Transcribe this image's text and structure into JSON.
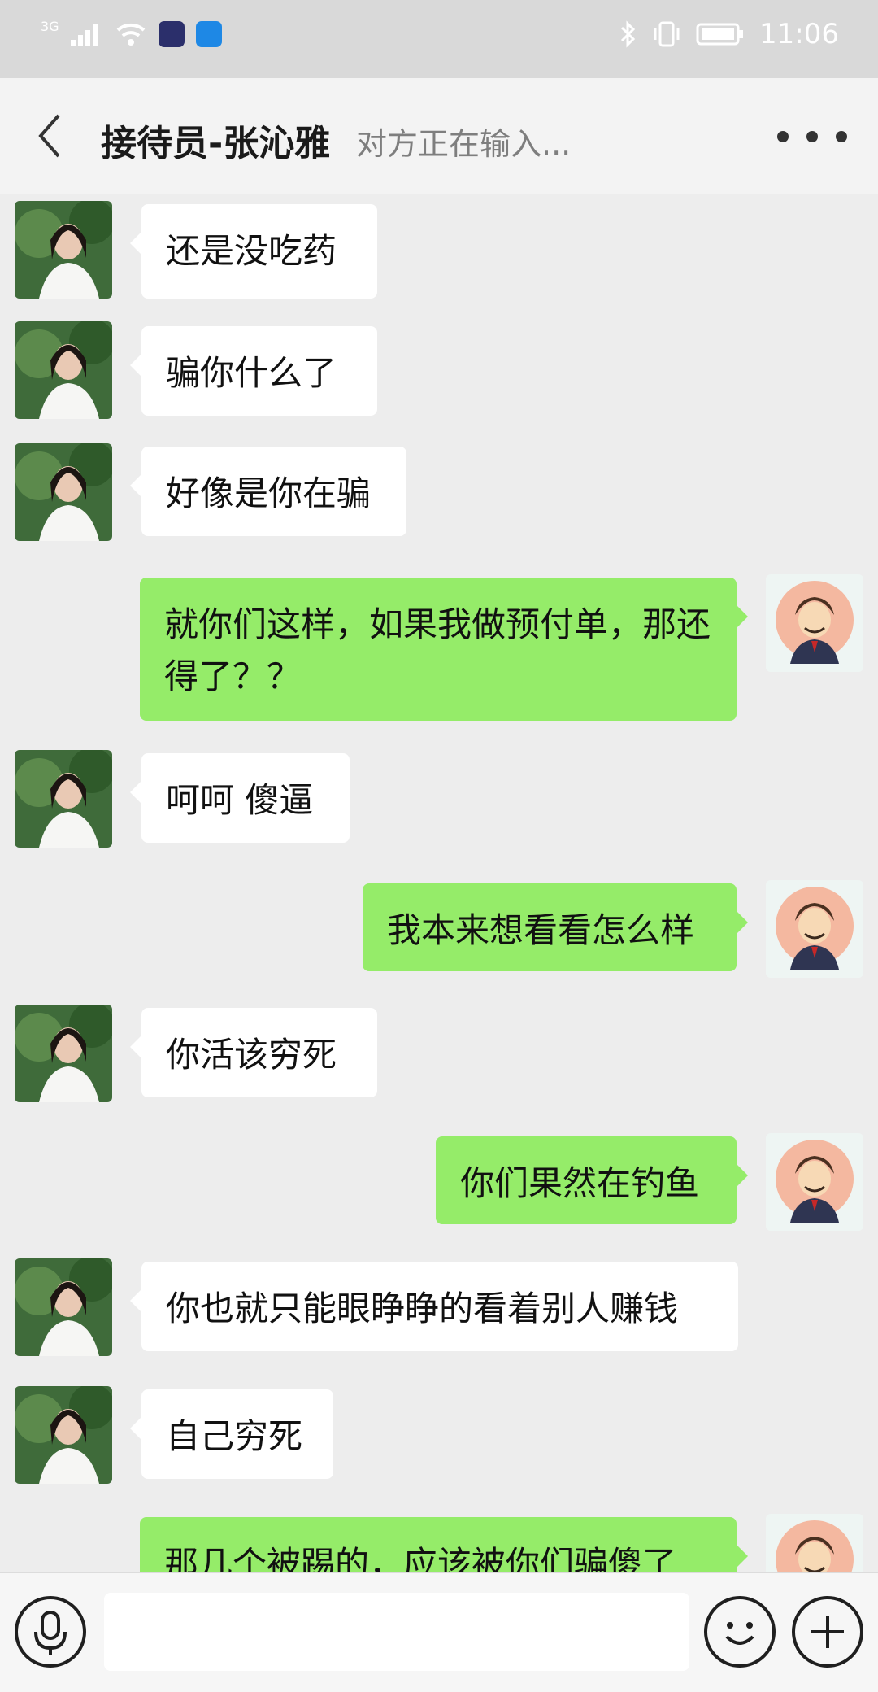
{
  "status_bar": {
    "network": "3G",
    "time": "11:06"
  },
  "header": {
    "title": "接待员-张沁雅",
    "typing_status": "对方正在输入..."
  },
  "messages": [
    {
      "side": "in",
      "text": "还是没吃药"
    },
    {
      "side": "in",
      "text": "骗你什么了"
    },
    {
      "side": "in",
      "text": "好像是你在骗"
    },
    {
      "side": "out",
      "text": "就你们这样，如果我做预付单，那还得了？？"
    },
    {
      "side": "in",
      "text": "呵呵 傻逼"
    },
    {
      "side": "out",
      "text": "我本来想看看怎么样"
    },
    {
      "side": "in",
      "text": "你活该穷死"
    },
    {
      "side": "out",
      "text": "你们果然在钓鱼"
    },
    {
      "side": "in",
      "text": "你也就只能眼睁睁的看着别人赚钱"
    },
    {
      "side": "in",
      "text": "自己穷死"
    },
    {
      "side": "out",
      "text": "那几个被踢的，应该被你们骗傻了"
    }
  ],
  "input_bar": {
    "placeholder": ""
  },
  "icons": {
    "back": "chevron-left-icon",
    "more": "more-dots-icon",
    "voice": "microphone-icon",
    "emoji": "smiley-icon",
    "plus": "plus-icon"
  },
  "colors": {
    "out_bubble": "#95ec69",
    "in_bubble": "#ffffff",
    "background": "#ededed"
  }
}
